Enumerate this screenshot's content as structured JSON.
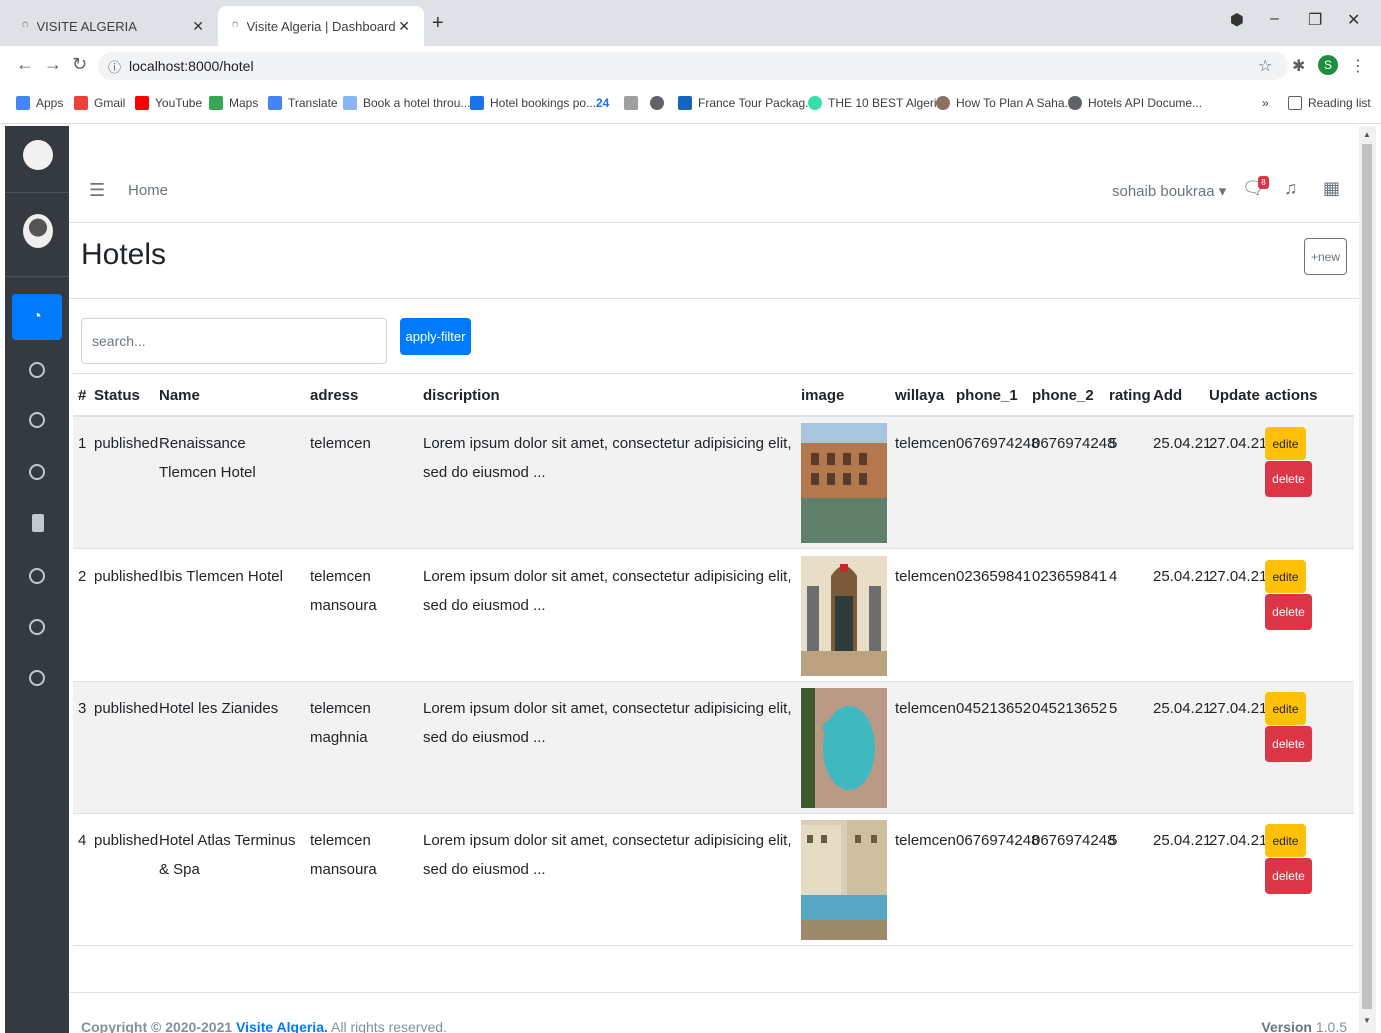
{
  "browser": {
    "tabs": [
      {
        "title": "VISITE ALGERIA",
        "active": false
      },
      {
        "title": "Visite Algeria | Dashboard",
        "active": true
      }
    ],
    "new_tab": "+",
    "url": "localhost:8000/hotel",
    "profile_initial": "S",
    "bookmarks": [
      {
        "label": "Apps",
        "icon": "apps-grid-icon",
        "color": "#4285f4"
      },
      {
        "label": "Gmail",
        "icon": "gmail-icon",
        "color": "#ea4335"
      },
      {
        "label": "YouTube",
        "icon": "youtube-icon",
        "color": "#ff0000"
      },
      {
        "label": "Maps",
        "icon": "maps-icon",
        "color": "#34a853"
      },
      {
        "label": "Translate",
        "icon": "translate-icon",
        "color": "#4285f4"
      },
      {
        "label": "Book a hotel throu...",
        "icon": "hotel-icon",
        "color": "#8ab4f8"
      },
      {
        "label": "Hotel bookings po...",
        "icon": "hotel-bookings-icon",
        "color": "#1a73e8"
      },
      {
        "label": "24",
        "icon": "twentyfour-icon",
        "color": "#1a73e8"
      },
      {
        "label": "",
        "icon": "doc-icon",
        "color": "#9e9e9e"
      },
      {
        "label": "",
        "icon": "globe-icon",
        "color": "#5f6368"
      },
      {
        "label": "France Tour Packag...",
        "icon": "tc-icon",
        "color": "#1565c0"
      },
      {
        "label": "THE 10 BEST Algeri...",
        "icon": "tripadvisor-icon",
        "color": "#34e0a1"
      },
      {
        "label": "How To Plan A Saha...",
        "icon": "plan-icon",
        "color": "#8d6e63"
      },
      {
        "label": "Hotels API Docume...",
        "icon": "api-doc-icon",
        "color": "#5f6368"
      }
    ],
    "more_bookmarks": "»",
    "reading_list": "Reading list"
  },
  "header": {
    "home": "Home",
    "user": "sohaib boukraa",
    "messages_badge": "8"
  },
  "page": {
    "title": "Hotels",
    "new_button": "+new",
    "search_placeholder": "search...",
    "filter_button": "apply-filter"
  },
  "table": {
    "columns": [
      "#",
      "Status",
      "Name",
      "adress",
      "discription",
      "image",
      "willaya",
      "phone_1",
      "phone_2",
      "rating",
      "Add",
      "Update",
      "actions"
    ],
    "rows": [
      {
        "id": "1",
        "status": "published",
        "name": "Renaissance Tlemcen Hotel",
        "adress": "telemcen",
        "discription": "Lorem ipsum dolor sit amet, consectetur adipisicing elit, sed do eiusmod ...",
        "willaya": "telemcen",
        "phone_1": "0676974248",
        "phone_2": "0676974248",
        "rating": "5",
        "add": "25.04.21",
        "update": "27.04.21",
        "image": "hotel-exterior-pool-image"
      },
      {
        "id": "2",
        "status": "published",
        "name": "Ibis Tlemcen Hotel",
        "adress": "telemcen mansoura",
        "discription": "Lorem ipsum dolor sit amet, consectetur adipisicing elit, sed do eiusmod ...",
        "willaya": "telemcen",
        "phone_1": "023659841",
        "phone_2": "023659841",
        "rating": "4",
        "add": "25.04.21",
        "update": "27.04.21",
        "image": "hotel-entrance-image"
      },
      {
        "id": "3",
        "status": "published",
        "name": "Hotel les Zianides",
        "adress": "telemcen maghnia",
        "discription": "Lorem ipsum dolor sit amet, consectetur adipisicing elit, sed do eiusmod ...",
        "willaya": "telemcen",
        "phone_1": "045213652",
        "phone_2": "045213652",
        "rating": "5",
        "add": "25.04.21",
        "update": "27.04.21",
        "image": "hotel-aerial-pool-image"
      },
      {
        "id": "4",
        "status": "published",
        "name": "Hotel Atlas Terminus & Spa",
        "adress": "telemcen mansoura",
        "discription": "Lorem ipsum dolor sit amet, consectetur adipisicing elit, sed do eiusmod ...",
        "willaya": "telemcen",
        "phone_1": "0676974248",
        "phone_2": "0676974248",
        "rating": "5",
        "add": "25.04.21",
        "update": "27.04.21",
        "image": "hotel-courtyard-pool-image"
      }
    ],
    "edit_label": "edite",
    "delete_label": "delete"
  },
  "footer": {
    "copyright": "Copyright © 2020-2021 ",
    "brand": "Visite Algeria.",
    "rights": " All rights reserved.",
    "version_label": "Version",
    "version": "1.0.5"
  }
}
